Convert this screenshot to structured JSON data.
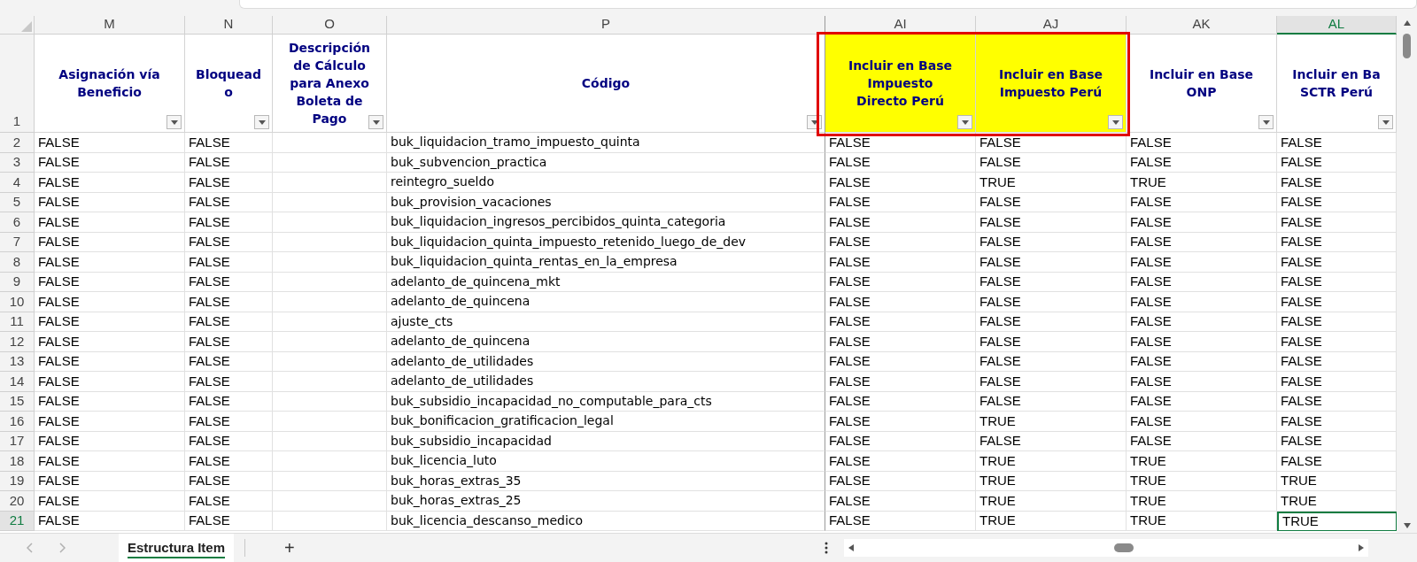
{
  "column_letters": [
    {
      "label": "M",
      "selected": false
    },
    {
      "label": "N",
      "selected": false
    },
    {
      "label": "O",
      "selected": false
    },
    {
      "label": "P",
      "selected": false
    },
    {
      "label": "AI",
      "selected": false
    },
    {
      "label": "AJ",
      "selected": false
    },
    {
      "label": "AK",
      "selected": false
    },
    {
      "label": "AL",
      "selected": true
    }
  ],
  "header_row": {
    "number": "1",
    "cells": [
      {
        "text": "Asignación vía\nBeneficio",
        "highlighted": false
      },
      {
        "text": "Bloquead\no",
        "highlighted": false
      },
      {
        "text": "Descripción\nde Cálculo\npara Anexo\nBoleta de\nPago",
        "highlighted": false
      },
      {
        "text": "Código",
        "highlighted": false
      },
      {
        "text": "Incluir en Base\nImpuesto\nDirecto Perú",
        "highlighted": true
      },
      {
        "text": "Incluir en Base\nImpuesto Perú",
        "highlighted": true
      },
      {
        "text": "Incluir en Base\nONP",
        "highlighted": false
      },
      {
        "text": "Incluir en Ba\nSCTR Perú",
        "highlighted": false
      }
    ]
  },
  "rows": [
    {
      "number": "2",
      "selected": false,
      "m": "FALSE",
      "n": "FALSE",
      "p": "buk_liquidacion_tramo_impuesto_quinta",
      "ai": "FALSE",
      "aj": "FALSE",
      "ak": "FALSE",
      "al": "FALSE"
    },
    {
      "number": "3",
      "selected": false,
      "m": "FALSE",
      "n": "FALSE",
      "p": "buk_subvencion_practica",
      "ai": "FALSE",
      "aj": "FALSE",
      "ak": "FALSE",
      "al": "FALSE"
    },
    {
      "number": "4",
      "selected": false,
      "m": "FALSE",
      "n": "FALSE",
      "p": "reintegro_sueldo",
      "ai": "FALSE",
      "aj": "TRUE",
      "ak": "TRUE",
      "al": "FALSE"
    },
    {
      "number": "5",
      "selected": false,
      "m": "FALSE",
      "n": "FALSE",
      "p": "buk_provision_vacaciones",
      "ai": "FALSE",
      "aj": "FALSE",
      "ak": "FALSE",
      "al": "FALSE"
    },
    {
      "number": "6",
      "selected": false,
      "m": "FALSE",
      "n": "FALSE",
      "p": "buk_liquidacion_ingresos_percibidos_quinta_categoria",
      "ai": "FALSE",
      "aj": "FALSE",
      "ak": "FALSE",
      "al": "FALSE"
    },
    {
      "number": "7",
      "selected": false,
      "m": "FALSE",
      "n": "FALSE",
      "p": "buk_liquidacion_quinta_impuesto_retenido_luego_de_dev",
      "ai": "FALSE",
      "aj": "FALSE",
      "ak": "FALSE",
      "al": "FALSE"
    },
    {
      "number": "8",
      "selected": false,
      "m": "FALSE",
      "n": "FALSE",
      "p": "buk_liquidacion_quinta_rentas_en_la_empresa",
      "ai": "FALSE",
      "aj": "FALSE",
      "ak": "FALSE",
      "al": "FALSE"
    },
    {
      "number": "9",
      "selected": false,
      "m": "FALSE",
      "n": "FALSE",
      "p": "adelanto_de_quincena_mkt",
      "ai": "FALSE",
      "aj": "FALSE",
      "ak": "FALSE",
      "al": "FALSE"
    },
    {
      "number": "10",
      "selected": false,
      "m": "FALSE",
      "n": "FALSE",
      "p": "adelanto_de_quincena",
      "ai": "FALSE",
      "aj": "FALSE",
      "ak": "FALSE",
      "al": "FALSE"
    },
    {
      "number": "11",
      "selected": false,
      "m": "FALSE",
      "n": "FALSE",
      "p": "ajuste_cts",
      "ai": "FALSE",
      "aj": "FALSE",
      "ak": "FALSE",
      "al": "FALSE"
    },
    {
      "number": "12",
      "selected": false,
      "m": "FALSE",
      "n": "FALSE",
      "p": "adelanto_de_quincena",
      "ai": "FALSE",
      "aj": "FALSE",
      "ak": "FALSE",
      "al": "FALSE"
    },
    {
      "number": "13",
      "selected": false,
      "m": "FALSE",
      "n": "FALSE",
      "p": "adelanto_de_utilidades",
      "ai": "FALSE",
      "aj": "FALSE",
      "ak": "FALSE",
      "al": "FALSE"
    },
    {
      "number": "14",
      "selected": false,
      "m": "FALSE",
      "n": "FALSE",
      "p": "adelanto_de_utilidades",
      "ai": "FALSE",
      "aj": "FALSE",
      "ak": "FALSE",
      "al": "FALSE"
    },
    {
      "number": "15",
      "selected": false,
      "m": "FALSE",
      "n": "FALSE",
      "p": "buk_subsidio_incapacidad_no_computable_para_cts",
      "ai": "FALSE",
      "aj": "FALSE",
      "ak": "FALSE",
      "al": "FALSE"
    },
    {
      "number": "16",
      "selected": false,
      "m": "FALSE",
      "n": "FALSE",
      "p": "buk_bonificacion_gratificacion_legal",
      "ai": "FALSE",
      "aj": "TRUE",
      "ak": "FALSE",
      "al": "FALSE"
    },
    {
      "number": "17",
      "selected": false,
      "m": "FALSE",
      "n": "FALSE",
      "p": "buk_subsidio_incapacidad",
      "ai": "FALSE",
      "aj": "FALSE",
      "ak": "FALSE",
      "al": "FALSE"
    },
    {
      "number": "18",
      "selected": false,
      "m": "FALSE",
      "n": "FALSE",
      "p": "buk_licencia_luto",
      "ai": "FALSE",
      "aj": "TRUE",
      "ak": "TRUE",
      "al": "FALSE"
    },
    {
      "number": "19",
      "selected": false,
      "m": "FALSE",
      "n": "FALSE",
      "p": "buk_horas_extras_35",
      "ai": "FALSE",
      "aj": "TRUE",
      "ak": "TRUE",
      "al": "TRUE"
    },
    {
      "number": "20",
      "selected": false,
      "m": "FALSE",
      "n": "FALSE",
      "p": "buk_horas_extras_25",
      "ai": "FALSE",
      "aj": "TRUE",
      "ak": "TRUE",
      "al": "TRUE"
    },
    {
      "number": "21",
      "selected": true,
      "m": "FALSE",
      "n": "FALSE",
      "p": "buk_licencia_descanso_medico",
      "ai": "FALSE",
      "aj": "TRUE",
      "ak": "TRUE",
      "al": "TRUE"
    }
  ],
  "sheet_tabs": [
    {
      "label": "Estructura Item",
      "selected": true
    }
  ],
  "add_sheet": "+"
}
